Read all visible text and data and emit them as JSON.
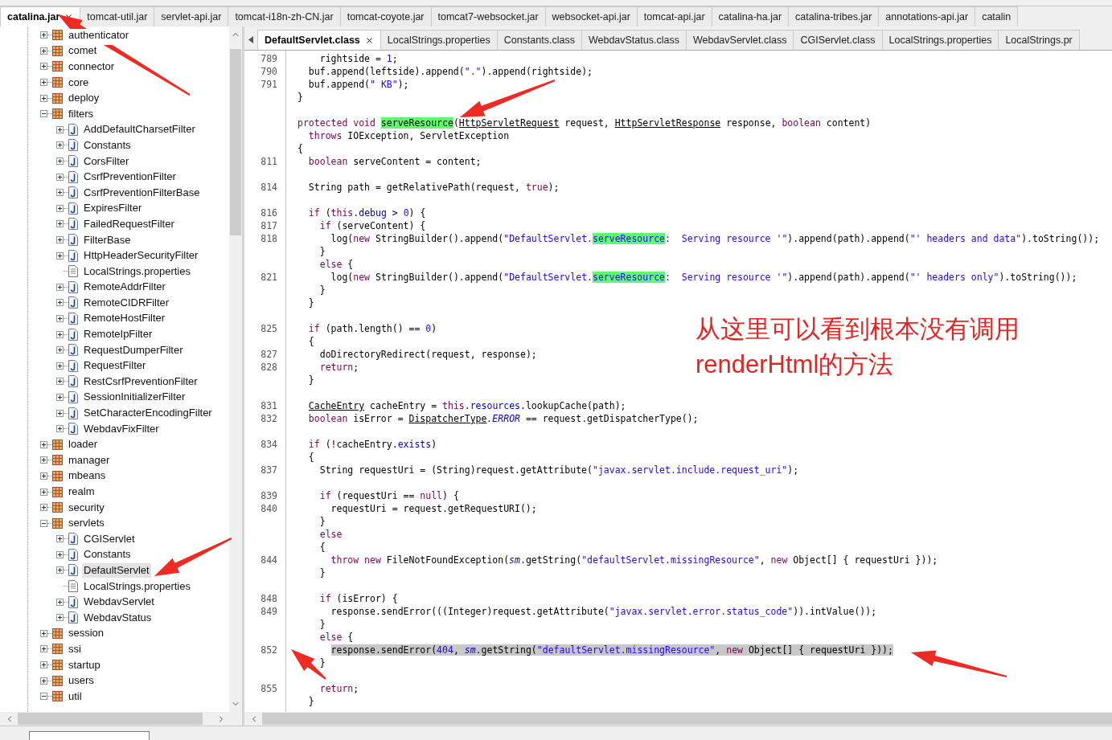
{
  "jar_tabs": [
    {
      "label": "catalina.jar",
      "selected": true
    },
    {
      "label": "tomcat-util.jar",
      "selected": false
    },
    {
      "label": "servlet-api.jar",
      "selected": false
    },
    {
      "label": "tomcat-i18n-zh-CN.jar",
      "selected": false
    },
    {
      "label": "tomcat-coyote.jar",
      "selected": false
    },
    {
      "label": "tomcat7-websocket.jar",
      "selected": false
    },
    {
      "label": "websocket-api.jar",
      "selected": false
    },
    {
      "label": "tomcat-api.jar",
      "selected": false
    },
    {
      "label": "catalina-ha.jar",
      "selected": false
    },
    {
      "label": "catalina-tribes.jar",
      "selected": false
    },
    {
      "label": "annotations-api.jar",
      "selected": false
    },
    {
      "label": "catalin",
      "selected": false
    }
  ],
  "tree": [
    {
      "label": "authenticator",
      "kind": "package",
      "expanded": false,
      "selected": false
    },
    {
      "label": "comet",
      "kind": "package",
      "expanded": false,
      "selected": false
    },
    {
      "label": "connector",
      "kind": "package",
      "expanded": false,
      "selected": false
    },
    {
      "label": "core",
      "kind": "package",
      "expanded": false,
      "selected": false
    },
    {
      "label": "deploy",
      "kind": "package",
      "expanded": false,
      "selected": false
    },
    {
      "label": "filters",
      "kind": "package",
      "expanded": true,
      "selected": false,
      "children": [
        {
          "label": "AddDefaultCharsetFilter",
          "kind": "class",
          "expanded": false,
          "selected": false
        },
        {
          "label": "Constants",
          "kind": "class",
          "expanded": false,
          "selected": false
        },
        {
          "label": "CorsFilter",
          "kind": "class",
          "expanded": false,
          "selected": false
        },
        {
          "label": "CsrfPreventionFilter",
          "kind": "class",
          "expanded": false,
          "selected": false
        },
        {
          "label": "CsrfPreventionFilterBase",
          "kind": "class",
          "expanded": false,
          "selected": false
        },
        {
          "label": "ExpiresFilter",
          "kind": "class",
          "expanded": false,
          "selected": false
        },
        {
          "label": "FailedRequestFilter",
          "kind": "class",
          "expanded": false,
          "selected": false
        },
        {
          "label": "FilterBase",
          "kind": "class",
          "expanded": false,
          "selected": false
        },
        {
          "label": "HttpHeaderSecurityFilter",
          "kind": "class",
          "expanded": false,
          "selected": false
        },
        {
          "label": "LocalStrings.properties",
          "kind": "file",
          "selected": false
        },
        {
          "label": "RemoteAddrFilter",
          "kind": "class",
          "expanded": false,
          "selected": false
        },
        {
          "label": "RemoteCIDRFilter",
          "kind": "class",
          "expanded": false,
          "selected": false
        },
        {
          "label": "RemoteHostFilter",
          "kind": "class",
          "expanded": false,
          "selected": false
        },
        {
          "label": "RemoteIpFilter",
          "kind": "class",
          "expanded": false,
          "selected": false
        },
        {
          "label": "RequestDumperFilter",
          "kind": "class",
          "expanded": false,
          "selected": false
        },
        {
          "label": "RequestFilter",
          "kind": "class",
          "expanded": false,
          "selected": false
        },
        {
          "label": "RestCsrfPreventionFilter",
          "kind": "class",
          "expanded": false,
          "selected": false
        },
        {
          "label": "SessionInitializerFilter",
          "kind": "class",
          "expanded": false,
          "selected": false
        },
        {
          "label": "SetCharacterEncodingFilter",
          "kind": "class",
          "expanded": false,
          "selected": false
        },
        {
          "label": "WebdavFixFilter",
          "kind": "class",
          "expanded": false,
          "selected": false
        }
      ]
    },
    {
      "label": "loader",
      "kind": "package",
      "expanded": false,
      "selected": false
    },
    {
      "label": "manager",
      "kind": "package",
      "expanded": false,
      "selected": false
    },
    {
      "label": "mbeans",
      "kind": "package",
      "expanded": false,
      "selected": false
    },
    {
      "label": "realm",
      "kind": "package",
      "expanded": false,
      "selected": false
    },
    {
      "label": "security",
      "kind": "package",
      "expanded": false,
      "selected": false
    },
    {
      "label": "servlets",
      "kind": "package",
      "expanded": true,
      "selected": false,
      "children": [
        {
          "label": "CGIServlet",
          "kind": "class",
          "expanded": false,
          "selected": false
        },
        {
          "label": "Constants",
          "kind": "class",
          "expanded": false,
          "selected": false
        },
        {
          "label": "DefaultServlet",
          "kind": "class",
          "expanded": false,
          "selected": true
        },
        {
          "label": "LocalStrings.properties",
          "kind": "file",
          "selected": false
        },
        {
          "label": "WebdavServlet",
          "kind": "class",
          "expanded": false,
          "selected": false
        },
        {
          "label": "WebdavStatus",
          "kind": "class",
          "expanded": false,
          "selected": false
        }
      ]
    },
    {
      "label": "session",
      "kind": "package",
      "expanded": false,
      "selected": false
    },
    {
      "label": "ssi",
      "kind": "package",
      "expanded": false,
      "selected": false
    },
    {
      "label": "startup",
      "kind": "package",
      "expanded": false,
      "selected": false
    },
    {
      "label": "users",
      "kind": "package",
      "expanded": false,
      "selected": false
    },
    {
      "label": "util",
      "kind": "package",
      "expanded": true,
      "selected": false
    }
  ],
  "editor_tabs": [
    {
      "label": "DefaultServlet.class",
      "selected": true
    },
    {
      "label": "LocalStrings.properties",
      "selected": false
    },
    {
      "label": "Constants.class",
      "selected": false
    },
    {
      "label": "WebdavStatus.class",
      "selected": false
    },
    {
      "label": "WebdavServlet.class",
      "selected": false
    },
    {
      "label": "CGIServlet.class",
      "selected": false
    },
    {
      "label": "LocalStrings.properties",
      "selected": false
    },
    {
      "label": "LocalStrings.pr",
      "selected": false
    }
  ],
  "code_lines": [
    {
      "number": "789",
      "tokens": [
        {
          "kind": "plain",
          "text": "    rightside = "
        },
        {
          "kind": "number",
          "text": "1"
        },
        {
          "kind": "plain",
          "text": ";"
        }
      ]
    },
    {
      "number": "790",
      "tokens": [
        {
          "kind": "plain",
          "text": "  buf.append(leftside).append("
        },
        {
          "kind": "string",
          "text": "\".\""
        },
        {
          "kind": "plain",
          "text": ").append(rightside);"
        }
      ]
    },
    {
      "number": "791",
      "tokens": [
        {
          "kind": "plain",
          "text": "  buf.append("
        },
        {
          "kind": "string",
          "text": "\" KB\""
        },
        {
          "kind": "plain",
          "text": ");"
        }
      ]
    },
    {
      "tokens": [
        {
          "kind": "plain",
          "text": "}"
        }
      ]
    },
    {
      "blank_before": true,
      "tokens": [
        {
          "kind": "keyword",
          "text": "protected void "
        },
        {
          "kind": "match",
          "text": "serveResource"
        },
        {
          "kind": "plain",
          "text": "("
        },
        {
          "kind": "type",
          "text": "HttpServletRequest"
        },
        {
          "kind": "plain",
          "text": " request, "
        },
        {
          "kind": "type",
          "text": "HttpServletResponse"
        },
        {
          "kind": "plain",
          "text": " response, "
        },
        {
          "kind": "keyword",
          "text": "boolean"
        },
        {
          "kind": "plain",
          "text": " content)"
        }
      ]
    },
    {
      "tokens": [
        {
          "kind": "keyword",
          "text": "  throws"
        },
        {
          "kind": "plain",
          "text": " IOException, ServletException"
        }
      ]
    },
    {
      "tokens": [
        {
          "kind": "plain",
          "text": "{"
        }
      ]
    },
    {
      "number": "811",
      "tokens": [
        {
          "kind": "keyword",
          "text": "  boolean"
        },
        {
          "kind": "plain",
          "text": " serveContent = content;"
        }
      ]
    },
    {
      "number": "814",
      "blank_before": true,
      "tokens": [
        {
          "kind": "plain",
          "text": "  String path = getRelativePath(request, "
        },
        {
          "kind": "keyword",
          "text": "true"
        },
        {
          "kind": "plain",
          "text": ");"
        }
      ]
    },
    {
      "number": "816",
      "blank_before": true,
      "tokens": [
        {
          "kind": "keyword",
          "text": "  if"
        },
        {
          "kind": "plain",
          "text": " ("
        },
        {
          "kind": "keyword",
          "text": "this"
        },
        {
          "kind": "plain",
          "text": "."
        },
        {
          "kind": "field",
          "text": "debug"
        },
        {
          "kind": "plain",
          "text": " > "
        },
        {
          "kind": "number",
          "text": "0"
        },
        {
          "kind": "plain",
          "text": ") {"
        }
      ]
    },
    {
      "number": "817",
      "tokens": [
        {
          "kind": "keyword",
          "text": "    if"
        },
        {
          "kind": "plain",
          "text": " (serveContent) {"
        }
      ]
    },
    {
      "number": "818",
      "tokens": [
        {
          "kind": "plain",
          "text": "      log("
        },
        {
          "kind": "keyword",
          "text": "new"
        },
        {
          "kind": "plain",
          "text": " StringBuilder().append("
        },
        {
          "kind": "string",
          "text": "\"DefaultServlet."
        },
        {
          "kind": "string_match",
          "text": "serveResource"
        },
        {
          "kind": "string",
          "text": ":  Serving resource '\""
        },
        {
          "kind": "plain",
          "text": ").append(path).append("
        },
        {
          "kind": "string",
          "text": "\"' headers and data\""
        },
        {
          "kind": "plain",
          "text": ").toString());"
        }
      ]
    },
    {
      "tokens": [
        {
          "kind": "plain",
          "text": "    }"
        }
      ]
    },
    {
      "tokens": [
        {
          "kind": "keyword",
          "text": "    else"
        },
        {
          "kind": "plain",
          "text": " {"
        }
      ]
    },
    {
      "number": "821",
      "tokens": [
        {
          "kind": "plain",
          "text": "      log("
        },
        {
          "kind": "keyword",
          "text": "new"
        },
        {
          "kind": "plain",
          "text": " StringBuilder().append("
        },
        {
          "kind": "string",
          "text": "\"DefaultServlet."
        },
        {
          "kind": "string_match",
          "text": "serveResource"
        },
        {
          "kind": "string",
          "text": ":  Serving resource '\""
        },
        {
          "kind": "plain",
          "text": ").append(path).append("
        },
        {
          "kind": "string",
          "text": "\"' headers only\""
        },
        {
          "kind": "plain",
          "text": ").toString());"
        }
      ]
    },
    {
      "tokens": [
        {
          "kind": "plain",
          "text": "    }"
        }
      ]
    },
    {
      "tokens": [
        {
          "kind": "plain",
          "text": "  }"
        }
      ]
    },
    {
      "number": "825",
      "blank_before": true,
      "tokens": [
        {
          "kind": "keyword",
          "text": "  if"
        },
        {
          "kind": "plain",
          "text": " (path.length() == "
        },
        {
          "kind": "number",
          "text": "0"
        },
        {
          "kind": "plain",
          "text": ")"
        }
      ]
    },
    {
      "tokens": [
        {
          "kind": "plain",
          "text": "  {"
        }
      ]
    },
    {
      "number": "827",
      "tokens": [
        {
          "kind": "plain",
          "text": "    doDirectoryRedirect(request, response);"
        }
      ]
    },
    {
      "number": "828",
      "tokens": [
        {
          "kind": "keyword",
          "text": "    return"
        },
        {
          "kind": "plain",
          "text": ";"
        }
      ]
    },
    {
      "tokens": [
        {
          "kind": "plain",
          "text": "  }"
        }
      ]
    },
    {
      "number": "831",
      "blank_before": true,
      "tokens": [
        {
          "kind": "type",
          "text": "  CacheEntry"
        },
        {
          "kind": "plain",
          "text": " cacheEntry = "
        },
        {
          "kind": "keyword",
          "text": "this"
        },
        {
          "kind": "plain",
          "text": "."
        },
        {
          "kind": "field",
          "text": "resources"
        },
        {
          "kind": "plain",
          "text": ".lookupCache(path);"
        }
      ]
    },
    {
      "number": "832",
      "tokens": [
        {
          "kind": "keyword",
          "text": "  boolean"
        },
        {
          "kind": "plain",
          "text": " isError = "
        },
        {
          "kind": "type",
          "text": "DispatcherType"
        },
        {
          "kind": "static",
          "text": ".ERROR"
        },
        {
          "kind": "plain",
          "text": " == request.getDispatcherType();"
        }
      ]
    },
    {
      "number": "834",
      "blank_before": true,
      "tokens": [
        {
          "kind": "keyword",
          "text": "  if"
        },
        {
          "kind": "plain",
          "text": " (!cacheEntry."
        },
        {
          "kind": "field",
          "text": "exists"
        },
        {
          "kind": "plain",
          "text": ")"
        }
      ]
    },
    {
      "tokens": [
        {
          "kind": "plain",
          "text": "  {"
        }
      ]
    },
    {
      "number": "837",
      "tokens": [
        {
          "kind": "plain",
          "text": "    String requestUri = (String)request.getAttribute("
        },
        {
          "kind": "string",
          "text": "\"javax.servlet.include.request_uri\""
        },
        {
          "kind": "plain",
          "text": ");"
        }
      ]
    },
    {
      "number": "839",
      "blank_before": true,
      "tokens": [
        {
          "kind": "keyword",
          "text": "    if"
        },
        {
          "kind": "plain",
          "text": " (requestUri == "
        },
        {
          "kind": "keyword",
          "text": "null"
        },
        {
          "kind": "plain",
          "text": ") {"
        }
      ]
    },
    {
      "number": "840",
      "tokens": [
        {
          "kind": "plain",
          "text": "      requestUri = request.getRequestURI();"
        }
      ]
    },
    {
      "tokens": [
        {
          "kind": "plain",
          "text": "    }"
        }
      ]
    },
    {
      "tokens": [
        {
          "kind": "keyword",
          "text": "    else"
        }
      ]
    },
    {
      "tokens": [
        {
          "kind": "plain",
          "text": "    {"
        }
      ]
    },
    {
      "number": "844",
      "tokens": [
        {
          "kind": "keyword",
          "text": "      throw new"
        },
        {
          "kind": "plain",
          "text": " FileNotFoundException("
        },
        {
          "kind": "static",
          "text": "sm"
        },
        {
          "kind": "plain",
          "text": ".getString("
        },
        {
          "kind": "string",
          "text": "\"defaultServlet.missingResource\""
        },
        {
          "kind": "plain",
          "text": ", "
        },
        {
          "kind": "keyword",
          "text": "new"
        },
        {
          "kind": "plain",
          "text": " Object[] { requestUri }));"
        }
      ]
    },
    {
      "tokens": [
        {
          "kind": "plain",
          "text": "    }"
        }
      ]
    },
    {
      "number": "848",
      "blank_before": true,
      "tokens": [
        {
          "kind": "keyword",
          "text": "    if"
        },
        {
          "kind": "plain",
          "text": " (isError) {"
        }
      ]
    },
    {
      "number": "849",
      "tokens": [
        {
          "kind": "plain",
          "text": "      response.sendError(((Integer)request.getAttribute("
        },
        {
          "kind": "string",
          "text": "\"javax.servlet.error.status_code\""
        },
        {
          "kind": "plain",
          "text": ")).intValue());"
        }
      ]
    },
    {
      "tokens": [
        {
          "kind": "plain",
          "text": "    }"
        }
      ]
    },
    {
      "tokens": [
        {
          "kind": "keyword",
          "text": "    else"
        },
        {
          "kind": "plain",
          "text": " {"
        }
      ]
    },
    {
      "number": "852",
      "highlighted": true,
      "tokens": [
        {
          "kind": "plain",
          "text": "      response.sendError("
        },
        {
          "kind": "number",
          "text": "404"
        },
        {
          "kind": "plain",
          "text": ", "
        },
        {
          "kind": "static",
          "text": "sm"
        },
        {
          "kind": "plain",
          "text": ".getString("
        },
        {
          "kind": "string",
          "text": "\"defaultServlet.missingResource\""
        },
        {
          "kind": "plain",
          "text": ", "
        },
        {
          "kind": "keyword",
          "text": "new"
        },
        {
          "kind": "plain",
          "text": " Object[] { requestUri }));"
        }
      ]
    },
    {
      "tokens": [
        {
          "kind": "plain",
          "text": "    }"
        }
      ]
    },
    {
      "number": "855",
      "blank_before": true,
      "tokens": [
        {
          "kind": "keyword",
          "text": "    return"
        },
        {
          "kind": "plain",
          "text": ";"
        }
      ]
    },
    {
      "tokens": [
        {
          "kind": "plain",
          "text": "  }"
        }
      ]
    }
  ],
  "annotation": {
    "text": "从这里可以看到根本没有调用renderHtml的方法"
  }
}
